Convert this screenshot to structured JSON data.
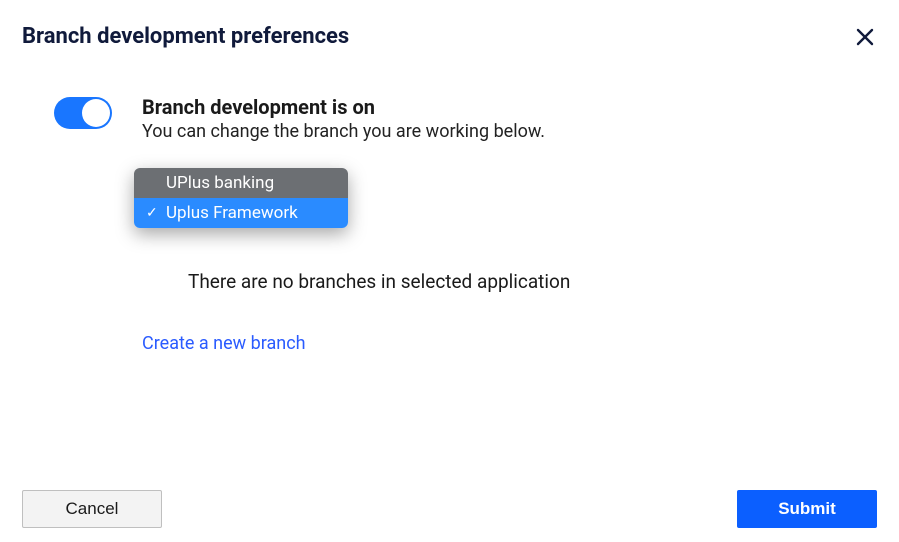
{
  "header": {
    "title": "Branch development preferences"
  },
  "status": {
    "title": "Branch development is on",
    "description": "You can change the branch you are working below."
  },
  "dropdown": {
    "options": [
      {
        "label": "UPlus banking",
        "selected": false
      },
      {
        "label": "Uplus Framework",
        "selected": true
      }
    ]
  },
  "main": {
    "empty_message": "There are no branches in selected application",
    "create_link": "Create a new branch"
  },
  "footer": {
    "cancel": "Cancel",
    "submit": "Submit"
  }
}
